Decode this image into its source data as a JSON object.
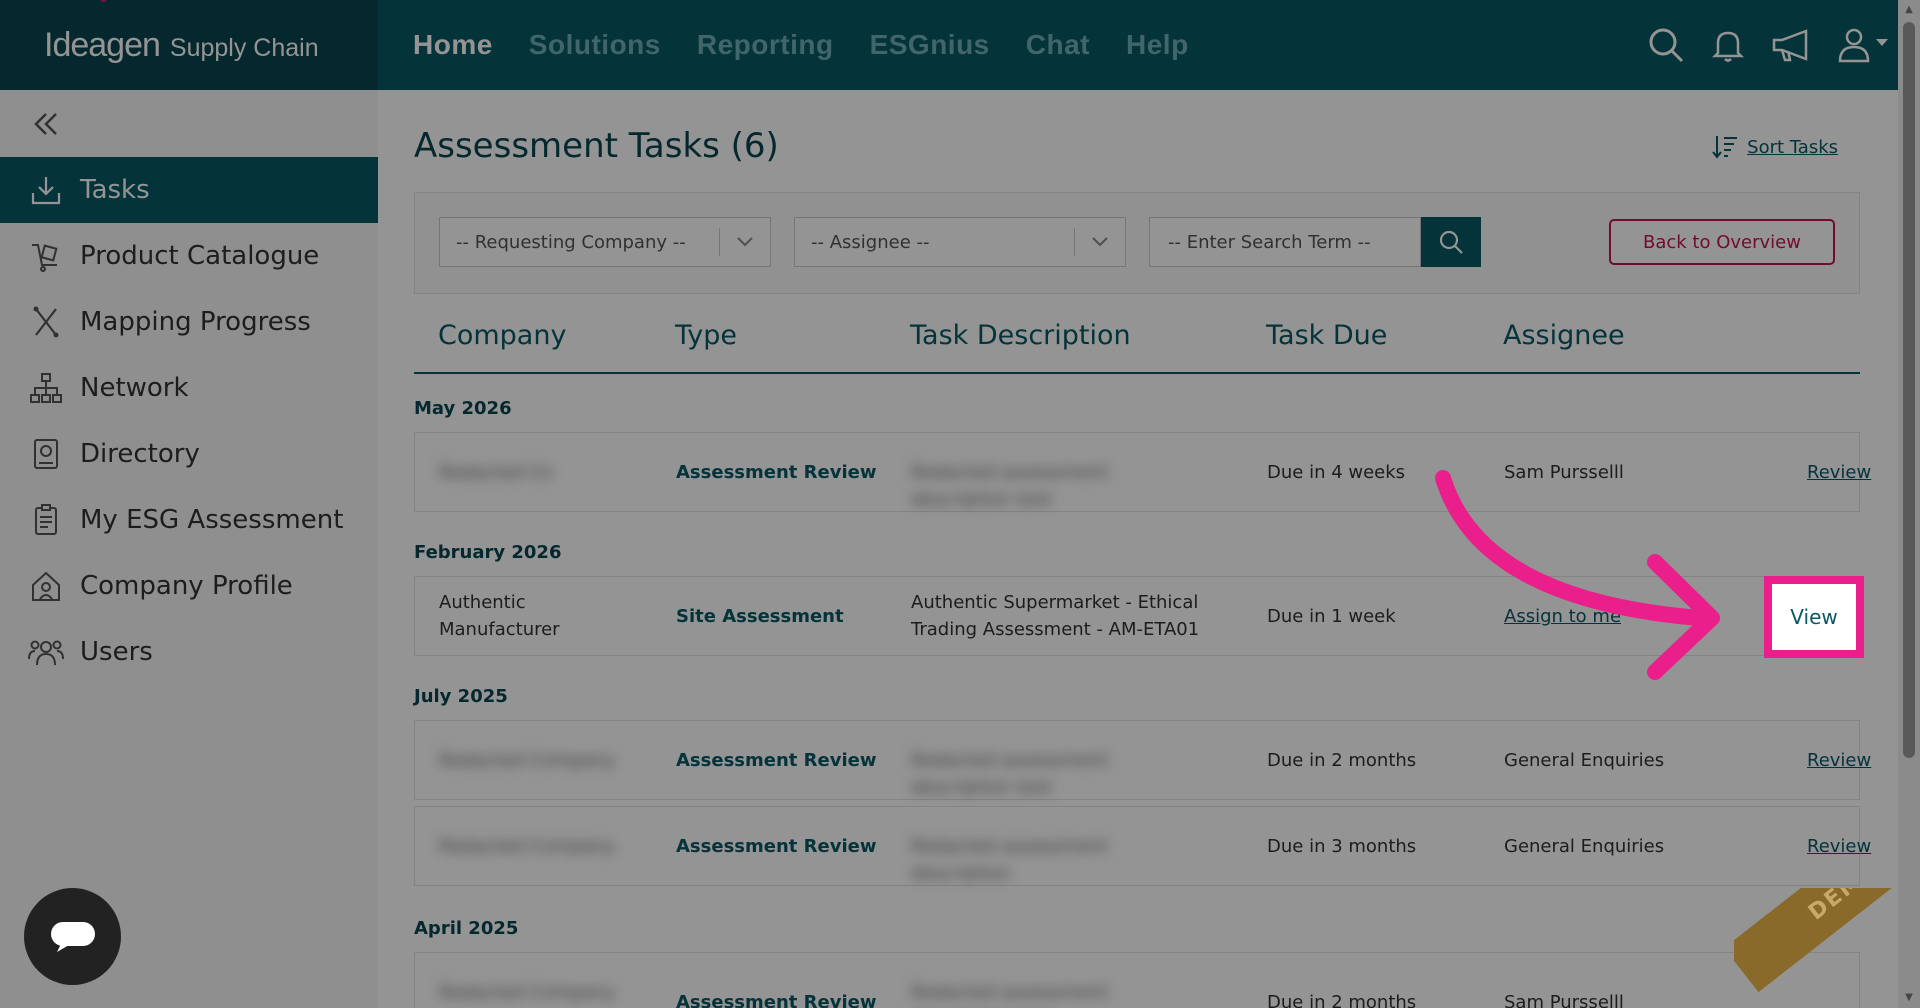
{
  "brand": {
    "name": "Ideagen",
    "product": "Supply Chain"
  },
  "nav": [
    "Home",
    "Solutions",
    "Reporting",
    "ESGnius",
    "Chat",
    "Help"
  ],
  "nav_active": "Home",
  "top_icons": [
    "search-icon",
    "bell-icon",
    "megaphone-icon",
    "user-icon"
  ],
  "sidebar": {
    "items": [
      {
        "label": "Tasks",
        "icon": "tasks-icon"
      },
      {
        "label": "Product Catalogue",
        "icon": "product-icon"
      },
      {
        "label": "Mapping Progress",
        "icon": "mapping-icon"
      },
      {
        "label": "Network",
        "icon": "network-icon"
      },
      {
        "label": "Directory",
        "icon": "directory-icon"
      },
      {
        "label": "My ESG Assessment",
        "icon": "clipboard-icon"
      },
      {
        "label": "Company Profile",
        "icon": "company-icon"
      },
      {
        "label": "Users",
        "icon": "users-icon"
      }
    ],
    "active": "Tasks"
  },
  "page": {
    "title": "Assessment Tasks (6)",
    "sort_label": "Sort Tasks",
    "filters": {
      "company_placeholder": "-- Requesting Company --",
      "assignee_placeholder": "-- Assignee --",
      "search_placeholder": "-- Enter Search Term --",
      "back_label": "Back to Overview"
    },
    "columns": [
      "Company",
      "Type",
      "Task Description",
      "Task Due",
      "Assignee"
    ]
  },
  "groups": [
    {
      "label": "May 2026"
    },
    {
      "label": "February 2026"
    },
    {
      "label": "July 2025"
    },
    {
      "label": "April 2025"
    }
  ],
  "rows": [
    {
      "company": "Redacted Co",
      "type": "Assessment Review",
      "description": "Redacted assessment description text",
      "due": "Due in 4 weeks",
      "assignee": "Sam Pursselll",
      "action": "Review"
    },
    {
      "company": "Authentic Manufacturer",
      "type": "Site Assessment",
      "description": "Authentic Supermarket - Ethical Trading Assessment - AM-ETA01",
      "due": "Due in 1 week",
      "assignee": "Assign to me",
      "action": "View"
    },
    {
      "company": "Redacted Company",
      "type": "Assessment Review",
      "description": "Redacted assessment description text",
      "due": "Due in 2 months",
      "assignee": "General Enquiries",
      "action": "Review"
    },
    {
      "company": "Redacted Company",
      "type": "Assessment Review",
      "description": "Redacted assessment description",
      "due": "Due in 3 months",
      "assignee": "General Enquiries",
      "action": "Review"
    },
    {
      "company": "Redacted Company",
      "type": "Assessment Review",
      "description": "Redacted assessment description text",
      "due": "Due in 2 months",
      "assignee": "Sam Pursselll",
      "action": ""
    }
  ],
  "demo_label": "DEMO",
  "colors": {
    "primary": "#0a5864",
    "accent": "#ea1f8b",
    "danger": "#c4154f"
  }
}
